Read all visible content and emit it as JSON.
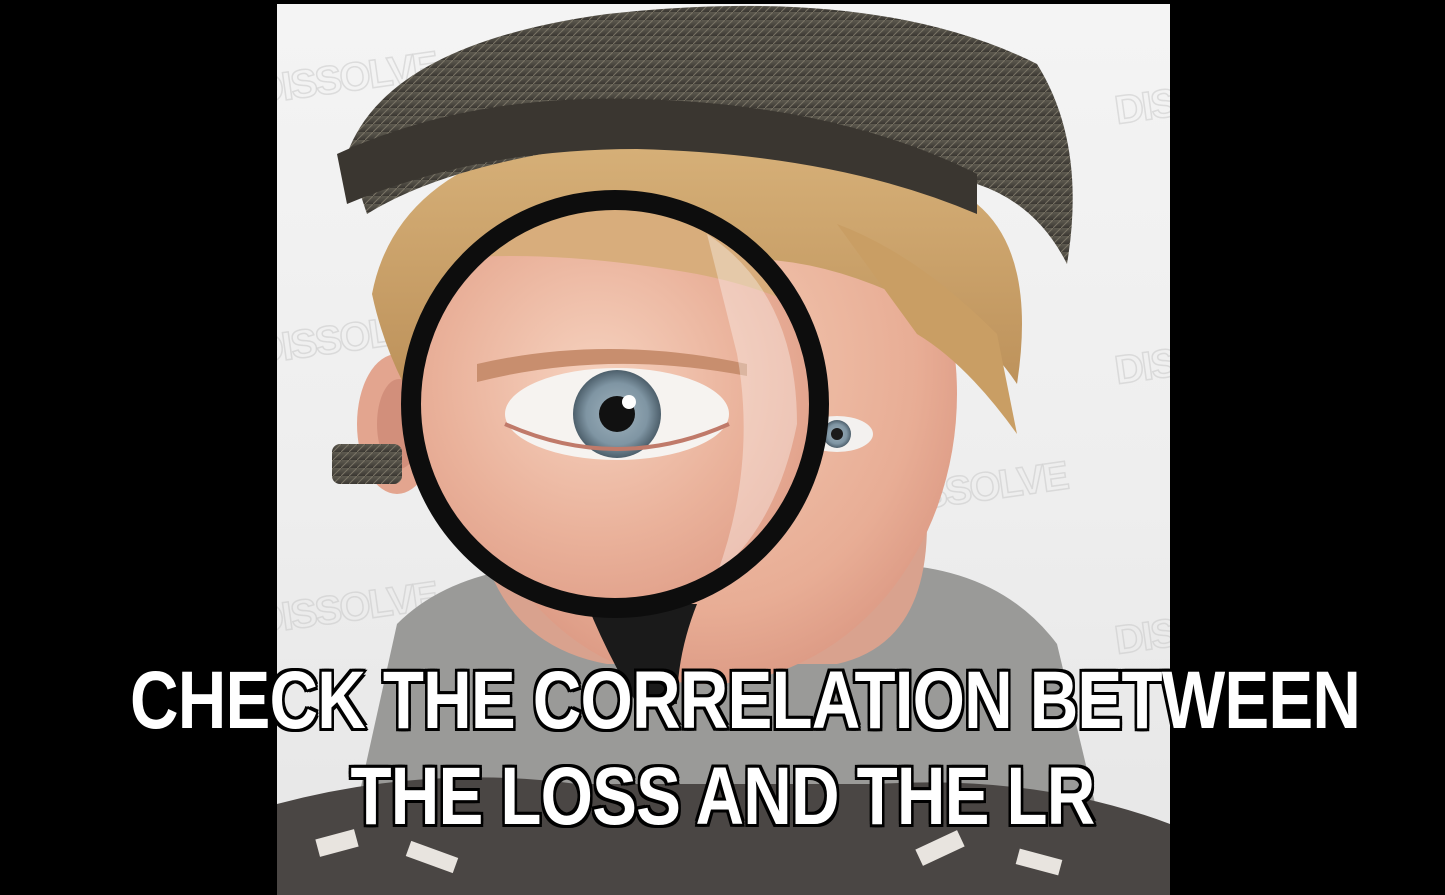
{
  "meme": {
    "caption_line1": "CHECK THE CORRELATION BETWEEN",
    "caption_line2": "THE LOSS AND THE LR",
    "watermark_text": "DISSOLVE",
    "colors": {
      "background": "#000000",
      "caption_fill": "#ffffff",
      "caption_outline": "#000000"
    }
  },
  "image": {
    "subject": "boy-with-magnifying-glass-icon"
  }
}
